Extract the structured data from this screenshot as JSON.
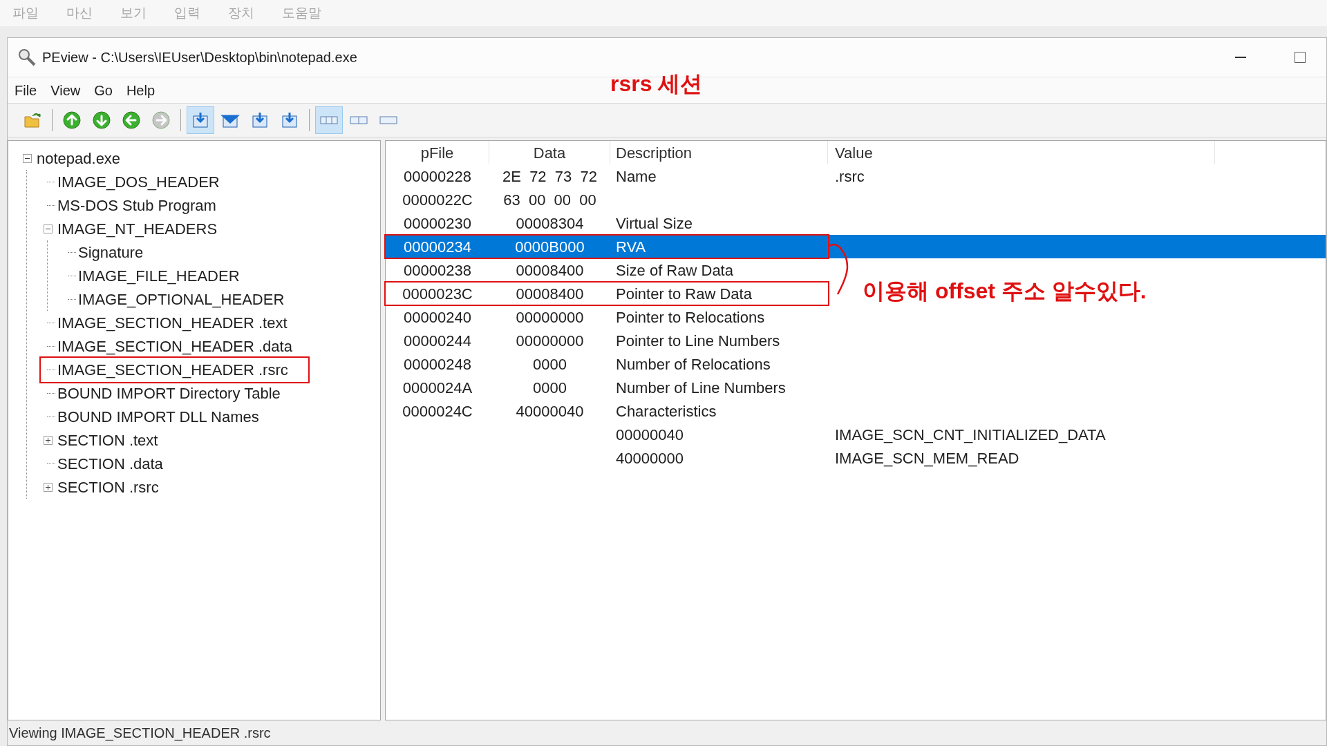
{
  "host_menu": [
    "파일",
    "마신",
    "보기",
    "입력",
    "장치",
    "도움말"
  ],
  "window": {
    "title": "PEview - C:\\Users\\IEUser\\Desktop\\bin\\notepad.exe"
  },
  "menu": [
    "File",
    "View",
    "Go",
    "Help"
  ],
  "toolbar": [
    {
      "kind": "open",
      "pressed": false,
      "disabled": false
    },
    {
      "kind": "sep"
    },
    {
      "kind": "up",
      "pressed": false,
      "disabled": false
    },
    {
      "kind": "down",
      "pressed": false,
      "disabled": false
    },
    {
      "kind": "back",
      "pressed": false,
      "disabled": false
    },
    {
      "kind": "forward",
      "pressed": false,
      "disabled": true
    },
    {
      "kind": "sep"
    },
    {
      "kind": "view1",
      "pressed": true,
      "disabled": false
    },
    {
      "kind": "view2",
      "pressed": false,
      "disabled": false
    },
    {
      "kind": "view3",
      "pressed": false,
      "disabled": false
    },
    {
      "kind": "view4",
      "pressed": false,
      "disabled": false
    },
    {
      "kind": "sep"
    },
    {
      "kind": "layout3",
      "pressed": true,
      "disabled": false
    },
    {
      "kind": "layout2",
      "pressed": false,
      "disabled": false
    },
    {
      "kind": "layout1",
      "pressed": false,
      "disabled": false
    }
  ],
  "tree": [
    {
      "label": "notepad.exe",
      "expanded": true,
      "annotated": false,
      "children": [
        {
          "label": "IMAGE_DOS_HEADER",
          "annotated": false
        },
        {
          "label": "MS-DOS Stub Program",
          "annotated": false
        },
        {
          "label": "IMAGE_NT_HEADERS",
          "expanded": true,
          "annotated": false,
          "children": [
            {
              "label": "Signature",
              "annotated": false
            },
            {
              "label": "IMAGE_FILE_HEADER",
              "annotated": false
            },
            {
              "label": "IMAGE_OPTIONAL_HEADER",
              "annotated": false
            }
          ]
        },
        {
          "label": "IMAGE_SECTION_HEADER .text",
          "annotated": false
        },
        {
          "label": "IMAGE_SECTION_HEADER .data",
          "annotated": false
        },
        {
          "label": "IMAGE_SECTION_HEADER .rsrc",
          "annotated": true
        },
        {
          "label": "BOUND IMPORT Directory Table",
          "annotated": false
        },
        {
          "label": "BOUND IMPORT DLL Names",
          "annotated": false
        },
        {
          "label": "SECTION .text",
          "expanded": false,
          "annotated": false
        },
        {
          "label": "SECTION .data",
          "annotated": false
        },
        {
          "label": "SECTION .rsrc",
          "expanded": false,
          "annotated": false
        }
      ]
    }
  ],
  "table": {
    "columns": [
      "pFile",
      "Data",
      "Description",
      "Value"
    ],
    "rows": [
      {
        "pfile": "00000228",
        "data": "2E  72  73  72",
        "description": "Name",
        "value": ".rsrc",
        "selected": false,
        "annotated": false
      },
      {
        "pfile": "0000022C",
        "data": "63  00  00  00",
        "selected": false,
        "annotated": false
      },
      {
        "pfile": "00000230",
        "data": "00008304",
        "description": "Virtual Size",
        "selected": false,
        "annotated": false
      },
      {
        "pfile": "00000234",
        "data": "0000B000",
        "description": "RVA",
        "selected": true,
        "annotated": true
      },
      {
        "pfile": "00000238",
        "data": "00008400",
        "description": "Size of Raw Data",
        "selected": false,
        "annotated": false
      },
      {
        "pfile": "0000023C",
        "data": "00008400",
        "description": "Pointer to Raw Data",
        "selected": false,
        "annotated": true
      },
      {
        "pfile": "00000240",
        "data": "00000000",
        "description": "Pointer to Relocations",
        "selected": false,
        "annotated": false
      },
      {
        "pfile": "00000244",
        "data": "00000000",
        "description": "Pointer to Line Numbers",
        "selected": false,
        "annotated": false
      },
      {
        "pfile": "00000248",
        "data": "0000",
        "description": "Number of Relocations",
        "selected": false,
        "annotated": false
      },
      {
        "pfile": "0000024A",
        "data": "0000",
        "description": "Number of Line Numbers",
        "selected": false,
        "annotated": false
      },
      {
        "pfile": "0000024C",
        "data": "40000040",
        "description": "Characteristics",
        "selected": false,
        "annotated": false
      },
      {
        "description": "00000040",
        "value": "IMAGE_SCN_CNT_INITIALIZED_DATA",
        "selected": false,
        "annotated": false
      },
      {
        "description": "40000000",
        "value": "IMAGE_SCN_MEM_READ",
        "selected": false,
        "annotated": false
      }
    ]
  },
  "annotations": {
    "title_note": "rsrs 세션",
    "side_note": "이용해 offset 주소 알수있다."
  },
  "status_bar": "Viewing IMAGE_SECTION_HEADER .rsrc"
}
